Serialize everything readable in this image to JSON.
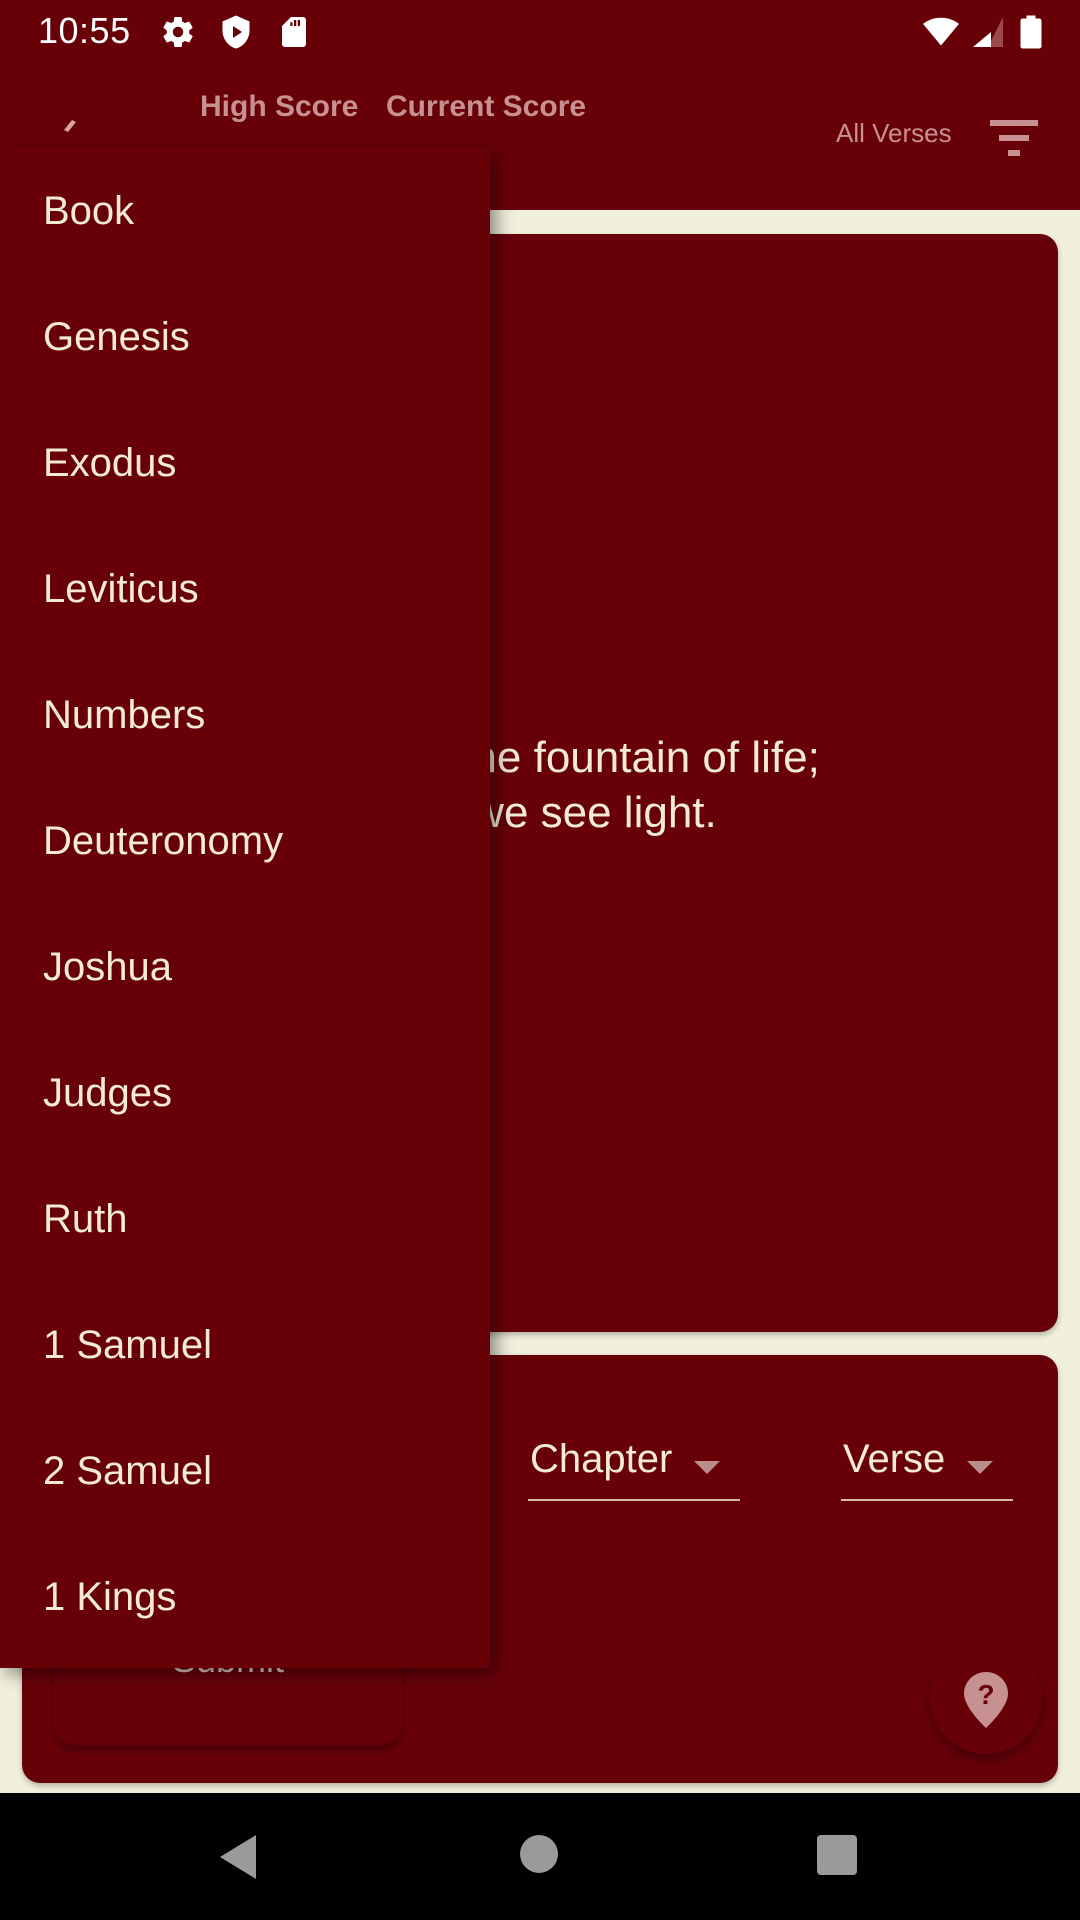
{
  "status_bar": {
    "time": "10:55",
    "left_icons": [
      "gear-icon",
      "shield-play-icon",
      "sd-card-icon"
    ],
    "right_icons": [
      "wifi-icon",
      "cell-signal-icon",
      "battery-icon"
    ]
  },
  "app_bar": {
    "high_score_label": "High Score",
    "current_score_label": "Current Score",
    "filter_label": "All Verses",
    "filter_icon": "filter-list-icon"
  },
  "verse_card": {
    "lines": [
      "the fountain of life;",
      "ht we see light."
    ]
  },
  "answer_card": {
    "chapter_select": {
      "label": "Chapter"
    },
    "verse_select": {
      "label": "Verse"
    },
    "submit_label": "Submit",
    "help_icon": "help-location-icon"
  },
  "book_dropdown": {
    "items": [
      "Book",
      "Genesis",
      "Exodus",
      "Leviticus",
      "Numbers",
      "Deuteronomy",
      "Joshua",
      "Judges",
      "Ruth",
      "1 Samuel",
      "2 Samuel",
      "1 Kings"
    ]
  },
  "nav_bar": {
    "buttons": [
      "back",
      "home",
      "recents"
    ]
  },
  "colors": {
    "primary": "#680008",
    "background": "#f1f0dc",
    "text_light": "#f3ead8",
    "text_muted": "#c79191"
  }
}
